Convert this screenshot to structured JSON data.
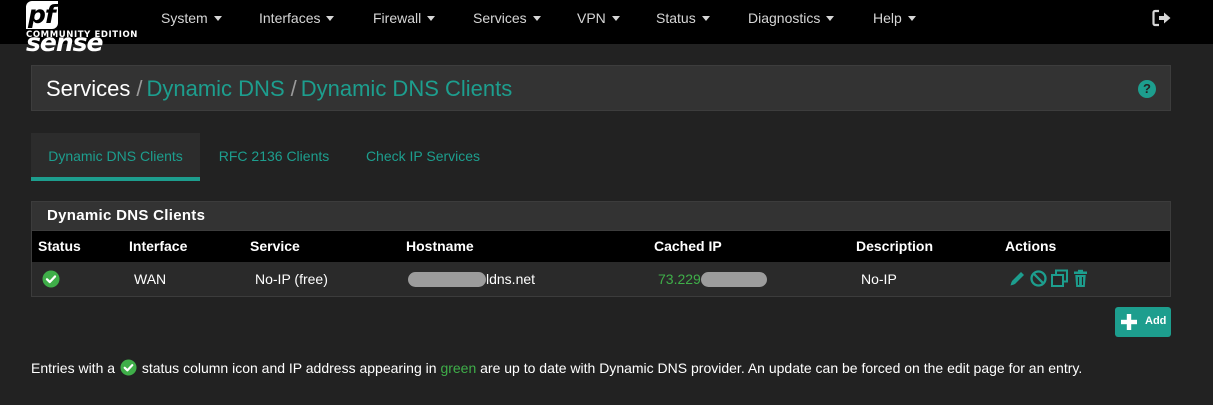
{
  "brand": {
    "logo_pf": "pf",
    "logo_sense": "sense",
    "logo_sub": "COMMUNITY EDITION"
  },
  "nav": {
    "items": [
      {
        "label": "System"
      },
      {
        "label": "Interfaces"
      },
      {
        "label": "Firewall"
      },
      {
        "label": "Services"
      },
      {
        "label": "VPN"
      },
      {
        "label": "Status"
      },
      {
        "label": "Diagnostics"
      },
      {
        "label": "Help"
      }
    ],
    "logout_icon": "sign-out-icon"
  },
  "breadcrumb": {
    "root": "Services",
    "sep": "/",
    "crumb1": "Dynamic DNS",
    "crumb2": "Dynamic DNS Clients"
  },
  "help_label": "?",
  "tabs": [
    {
      "label": "Dynamic DNS Clients",
      "active": true
    },
    {
      "label": "RFC 2136 Clients",
      "active": false
    },
    {
      "label": "Check IP Services",
      "active": false
    }
  ],
  "panel": {
    "title": "Dynamic DNS Clients",
    "columns": [
      "Status",
      "Interface",
      "Service",
      "Hostname",
      "Cached IP",
      "Description",
      "Actions"
    ],
    "rows": [
      {
        "status_icon": "check-circle-icon",
        "interface": "WAN",
        "service": "No-IP (free)",
        "hostname_suffix": "ldns.net",
        "cached_ip_prefix": "73.229",
        "description": "No-IP"
      }
    ]
  },
  "add_button": {
    "label": "Add"
  },
  "note": {
    "part1": "Entries with a",
    "part2": "status column icon and IP address appearing in",
    "green_word": "green",
    "part3": "are up to date with Dynamic DNS provider. An update can be forced on the edit page for an entry."
  },
  "colors": {
    "accent": "#1d9e8e",
    "ok_green": "#3fae49",
    "navbar": "#000000",
    "background": "#222222"
  }
}
